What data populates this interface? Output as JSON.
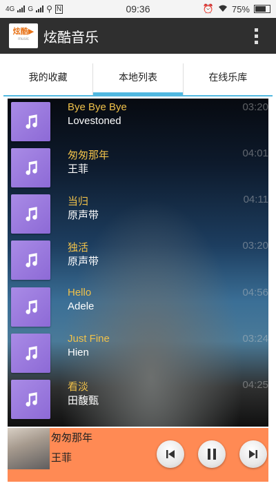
{
  "status_bar": {
    "network_1": "4G",
    "network_2": "G",
    "time": "09:36",
    "battery": "75%"
  },
  "app": {
    "title": "炫酷音乐"
  },
  "tabs": [
    {
      "label": "我的收藏",
      "active": false
    },
    {
      "label": "本地列表",
      "active": true
    },
    {
      "label": "在线乐库",
      "active": false
    }
  ],
  "songs": [
    {
      "title": "Bye Bye Bye",
      "artist": "Lovestoned",
      "duration": "03:20"
    },
    {
      "title": "匆匆那年",
      "artist": "王菲",
      "duration": "04:01"
    },
    {
      "title": "当归",
      "artist": "原声带",
      "duration": "04:11"
    },
    {
      "title": "独活",
      "artist": "原声带",
      "duration": "03:20"
    },
    {
      "title": "Hello",
      "artist": "Adele",
      "duration": "04:56"
    },
    {
      "title": "Just Fine",
      "artist": "Hien",
      "duration": "03:24"
    },
    {
      "title": "看淡",
      "artist": "田馥甄",
      "duration": "04:25"
    }
  ],
  "now_playing": {
    "title": "匆匆那年",
    "artist": "王菲"
  },
  "icons": {
    "cover": "music-note-icon",
    "prev": "skip-previous-icon",
    "play": "pause-icon",
    "next": "skip-next-icon"
  },
  "colors": {
    "accent": "#51b8e0",
    "player_bg": "#ff8a54",
    "title_text": "#f0c14a",
    "cover_bg": "#9a7adf"
  }
}
